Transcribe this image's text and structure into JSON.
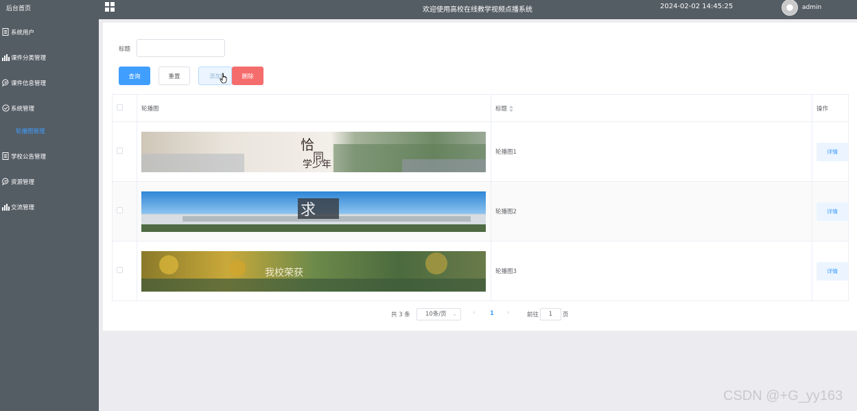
{
  "sidebar": {
    "home": "后台首页",
    "items": [
      {
        "label": "系统用户",
        "icon": "document-icon"
      },
      {
        "label": "课件分类管理",
        "icon": "bar-chart-icon"
      },
      {
        "label": "课件信息管理",
        "icon": "chat-icon"
      },
      {
        "label": "系统管理",
        "icon": "check-circle-icon"
      }
    ],
    "sub_active": "轮播图管理",
    "items2": [
      {
        "label": "学校公告管理",
        "icon": "document-icon"
      },
      {
        "label": "资源管理",
        "icon": "chat-icon"
      },
      {
        "label": "交流管理",
        "icon": "bar-chart-icon"
      }
    ]
  },
  "header": {
    "title": "欢迎使用高校在线教学视频点播系统",
    "datetime": "2024-02-02 14:45:25",
    "user": "admin"
  },
  "search": {
    "label": "标题",
    "value": ""
  },
  "buttons": {
    "query": "查询",
    "reset": "重置",
    "add": "添加",
    "delete": "删除"
  },
  "table": {
    "headers": {
      "image": "轮播图",
      "title": "标题",
      "action": "操作"
    },
    "rows": [
      {
        "title": "轮播图1",
        "action": "详情"
      },
      {
        "title": "轮播图2",
        "action": "详情"
      },
      {
        "title": "轮播图3",
        "action": "详情"
      }
    ]
  },
  "pagination": {
    "total": "共 3 条",
    "page_size": "10条/页",
    "current": "1",
    "goto_label": "前往",
    "goto_value": "1",
    "page_suffix": "页"
  },
  "watermark": "CSDN @+G_yy163",
  "colors": {
    "sidebar_bg": "#545c64",
    "primary": "#409eff",
    "danger": "#f56c6c"
  }
}
